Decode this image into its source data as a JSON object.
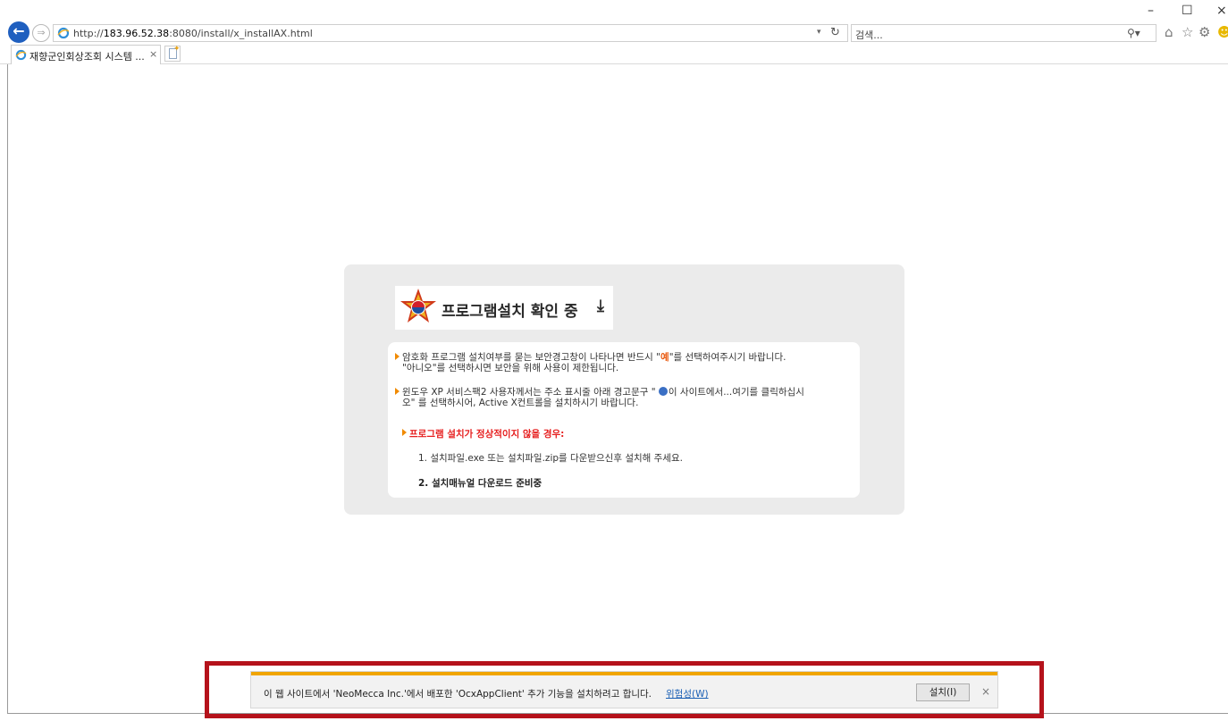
{
  "browser": {
    "url_prefix": "http://",
    "url_host": "183.96.52.38",
    "url_rest": ":8080/install/x_installAX.html",
    "search_placeholder": "검색...",
    "tab_title": "재향군인회상조회 시스템 ...",
    "tab_close": "×",
    "window_controls": {
      "minimize": "–",
      "maximize": "☐",
      "close": "×"
    },
    "icons": [
      "home-icon",
      "favorites-icon",
      "settings-icon",
      "smiley-icon"
    ]
  },
  "panel": {
    "logo_title": "프로그램설치 확인 중",
    "download_glyph": "⤓",
    "msg1_a": "암호화 프로그램 설치여부를 묻는 보안경고창이 나타나면 반드시 \"",
    "msg1_hl": "예",
    "msg1_b": "\"를 선택하여주시기 바랍니다.",
    "msg1_line2": "\"아니오\"를 선택하시면 보안을 위해 사용이 제한됩니다.",
    "msg2_a": "윈도우 XP 서비스팩2 사용자께서는 주소 표시줄 아래 경고문구 \" ",
    "msg2_b": "이 사이트에서...여기를 클릭하십시",
    "msg2_line2": "오\" 를 선택하시어, Active X컨트롤을 설치하시기 바랍니다.",
    "warning_heading": "프로그램 설치가 정상적이지 않을 경우:",
    "step1": "1. 설치파일.exe 또는 설치파일.zip를 다운받으신후 설치해 주세요.",
    "step2": "2. 설치매뉴얼 다운로드 준비중"
  },
  "notification": {
    "text": "이 웹 사이트에서 'NeoMecca Inc.'에서 배포한 'OcxAppClient' 추가 기능을 설치하려고 합니다.",
    "risk_link": "위험성(W)",
    "install_button": "설치(I)",
    "close": "×",
    "accent_color": "#f0a500",
    "outline_color": "#b5121b"
  }
}
